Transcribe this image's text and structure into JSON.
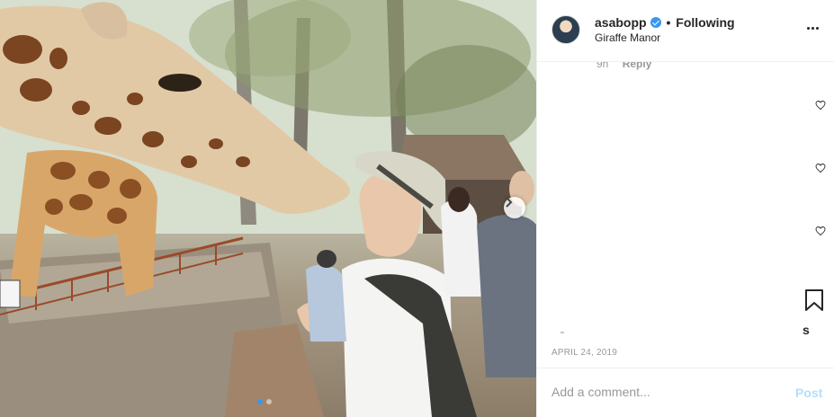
{
  "post": {
    "photo_alt_icon": "giraffe-kiss-photo",
    "carousel": {
      "total": 2,
      "active": 1
    },
    "next_icon": "chevron-right-icon"
  },
  "header": {
    "username": "asabopp",
    "separator": "•",
    "follow_status": "Following",
    "location": "Giraffe Manor",
    "verified_icon": "verified-badge-icon",
    "more_icon": "more-options-icon"
  },
  "comments": {
    "age": "9h",
    "reply_label": "Reply"
  },
  "actions": {
    "likes_fragment": "s",
    "bookmark_icon": "bookmark-icon",
    "heart_icon": "heart-icon"
  },
  "date": "APRIL 24, 2019",
  "comment_box": {
    "placeholder": "Add a comment...",
    "post_label": "Post"
  },
  "colors": {
    "accent": "#3897f0",
    "post_disabled": "#b2dffc",
    "muted": "#999999"
  }
}
